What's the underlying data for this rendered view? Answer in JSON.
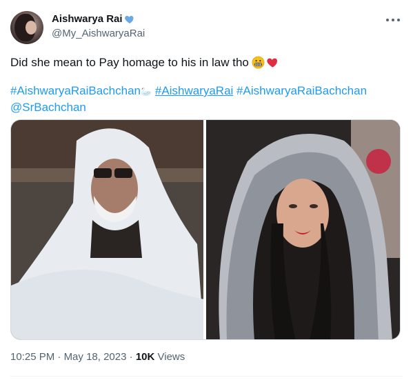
{
  "author": {
    "display_name": "Aishwarya Rai",
    "handle": "@My_AishwaryaRai",
    "verified_badge_color": "#6aa8e8"
  },
  "tweet": {
    "text": "Did she mean to Pay homage to his in law tho",
    "emojis": [
      "grimacing-face",
      "red-heart"
    ],
    "hashtags": [
      {
        "text": "#AishwaryaRaiBachchan",
        "emoji": "🦢"
      },
      {
        "text": "#AishwaryaRai"
      },
      {
        "text": "#AishwaryaRaiBachchan"
      }
    ],
    "mention": "@SrBachchan"
  },
  "media": {
    "left_image": "amitabh-bachchan-white-shawl",
    "right_image": "aishwarya-rai-sequin-hood"
  },
  "meta": {
    "time": "10:25 PM",
    "separator": "·",
    "date": "May 18, 2023",
    "views_count": "10K",
    "views_label": "Views"
  },
  "colors": {
    "link": "#1d9bf0",
    "secondary_text": "#536471",
    "primary_text": "#0f1419"
  }
}
